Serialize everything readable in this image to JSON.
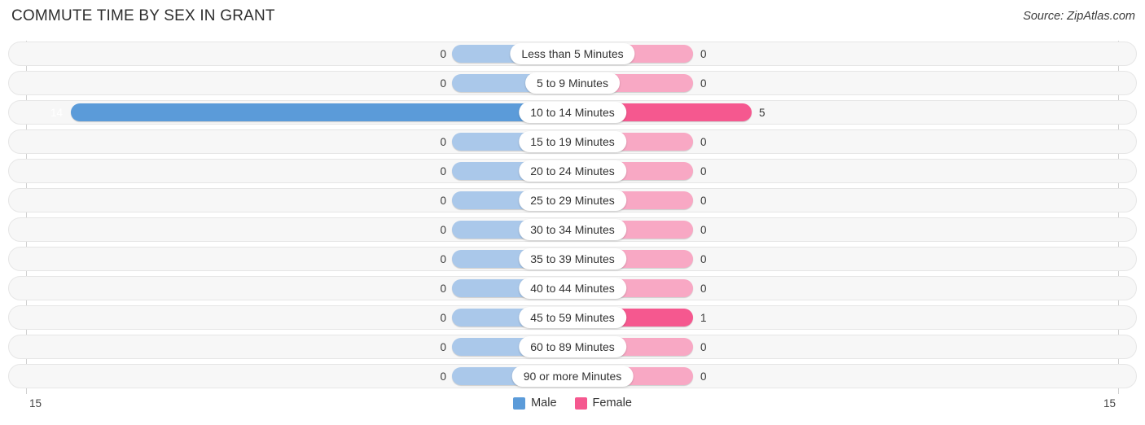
{
  "header": {
    "title": "COMMUTE TIME BY SEX IN GRANT",
    "source": "Source: ZipAtlas.com"
  },
  "colors": {
    "male_strong": "#5b9bd9",
    "male_light": "#aac8ea",
    "female_strong": "#f5588f",
    "female_light": "#f8a8c4",
    "row_background": "#f7f7f7",
    "row_border": "#e6e6e6",
    "axis_line": "#d0d0d0",
    "pill_background": "#ffffff"
  },
  "chart_data": {
    "type": "bar",
    "subtype": "diverging-horizontal",
    "title": "COMMUTE TIME BY SEX IN GRANT",
    "xlabel": "",
    "ylabel": "",
    "axis_max_left": "15",
    "axis_max_right": "15",
    "xlim": [
      15,
      15
    ],
    "grid": false,
    "legend_position": "bottom-center",
    "categories": [
      "Less than 5 Minutes",
      "5 to 9 Minutes",
      "10 to 14 Minutes",
      "15 to 19 Minutes",
      "20 to 24 Minutes",
      "25 to 29 Minutes",
      "30 to 34 Minutes",
      "35 to 39 Minutes",
      "40 to 44 Minutes",
      "45 to 59 Minutes",
      "60 to 89 Minutes",
      "90 or more Minutes"
    ],
    "series": [
      {
        "name": "Male",
        "side": "left",
        "color": "#5b9bd9",
        "values": [
          0,
          0,
          14,
          0,
          0,
          0,
          0,
          0,
          0,
          0,
          0,
          0
        ],
        "labels": [
          "0",
          "0",
          "14",
          "0",
          "0",
          "0",
          "0",
          "0",
          "0",
          "0",
          "0",
          "0"
        ]
      },
      {
        "name": "Female",
        "side": "right",
        "color": "#f5588f",
        "values": [
          0,
          0,
          5,
          0,
          0,
          0,
          0,
          0,
          0,
          1,
          0,
          0
        ],
        "labels": [
          "0",
          "0",
          "5",
          "0",
          "0",
          "0",
          "0",
          "0",
          "0",
          "1",
          "0",
          "0"
        ]
      }
    ]
  },
  "legend": {
    "items": [
      {
        "label": "Male",
        "color": "#5b9bd9"
      },
      {
        "label": "Female",
        "color": "#f5588f"
      }
    ]
  }
}
